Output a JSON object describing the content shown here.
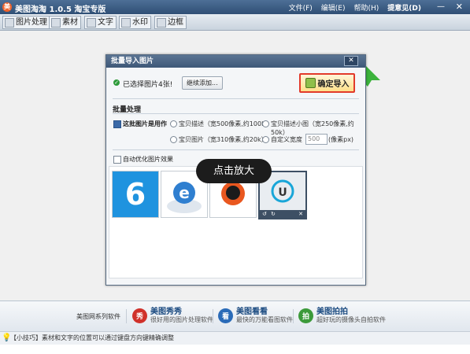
{
  "app": {
    "title": "美图淘淘 1.0.5 淘宝专版",
    "menu": [
      "文件(F)",
      "编辑(E)",
      "帮助(H)",
      "提意见(D)"
    ],
    "minimize": "—",
    "close": "✕"
  },
  "tabs": [
    "图片处理",
    "素材",
    "文字",
    "水印",
    "边框"
  ],
  "dialog": {
    "title": "批量导入图片",
    "close": "✕",
    "selected_text": "已选择图片4张!",
    "add_button": "继续添加...",
    "confirm_button": "确定导入",
    "section_title": "批量处理",
    "apply_label": "这批图片是用作",
    "options": [
      "宝贝描述（宽500像素,约100k）",
      "宝贝描述小图（宽250像素,约50k）",
      "宝贝图片（宽310像素,约20k）",
      "自定义宽度"
    ],
    "custom_width": "500",
    "unit": "(像素px)",
    "optimize_label": "自动优化图片效果",
    "thumb_tools": {
      "rotate_left": "↺",
      "rotate_right": "↻",
      "delete": "✕"
    }
  },
  "tooltip": "点击放大",
  "bottom": {
    "brand": "美图网系列软件",
    "products": [
      {
        "name": "美图秀秀",
        "desc": "很好用的图片处理软件",
        "icon": "xiu",
        "color": "#d0312a"
      },
      {
        "name": "美图看看",
        "desc": "最快的万能看图软件",
        "icon": "kan",
        "color": "#2a6bb8"
      },
      {
        "name": "美图拍拍",
        "desc": "超好玩的摄像头自拍软件",
        "icon": "pai",
        "color": "#3c9a3a"
      }
    ],
    "icon_text": [
      "秀",
      "看",
      "拍"
    ]
  },
  "status": {
    "tip": "【小技巧】素材和文字的位置可以通过键盘方向键精确调整"
  }
}
